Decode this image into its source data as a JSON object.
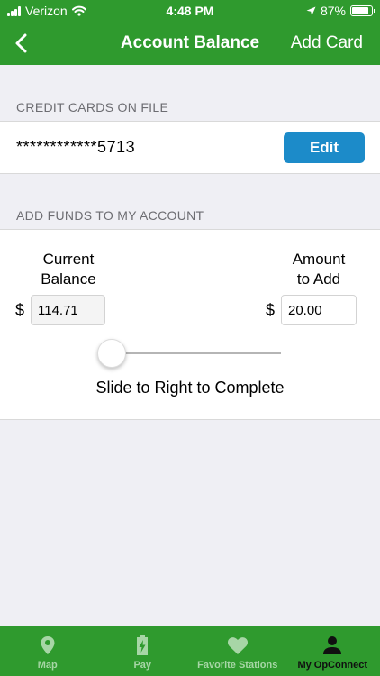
{
  "status_bar": {
    "carrier": "Verizon",
    "time": "4:48 PM",
    "battery": "87%",
    "battery_level": 0.87
  },
  "nav": {
    "title": "Account Balance",
    "action_label": "Add Card",
    "back_icon": "chevron-left-icon"
  },
  "credit_cards": {
    "header": "CREDIT CARDS ON FILE",
    "card_number": "************5713",
    "edit_label": "Edit"
  },
  "add_funds": {
    "header": "ADD FUNDS TO MY ACCOUNT",
    "current_balance": {
      "label_line1": "Current",
      "label_line2": "Balance",
      "currency": "$",
      "value": "114.71"
    },
    "amount_to_add": {
      "label_line1": "Amount",
      "label_line2": "to Add",
      "currency": "$",
      "value": "20.00"
    },
    "slider": {
      "position": 0,
      "label": "Slide to Right to Complete"
    }
  },
  "tabs": [
    {
      "label": "Map",
      "icon": "map-pin-icon",
      "active": false
    },
    {
      "label": "Pay",
      "icon": "battery-charge-icon",
      "active": false
    },
    {
      "label": "Favorite Stations",
      "icon": "heart-icon",
      "active": false
    },
    {
      "label": "My OpConnect",
      "icon": "person-icon",
      "active": true
    }
  ],
  "colors": {
    "brand_green": "#2f9a2e",
    "button_blue": "#1c8bc9",
    "tab_inactive": "#a7d6a6",
    "tab_active": "#101010",
    "background": "#efeff4"
  }
}
